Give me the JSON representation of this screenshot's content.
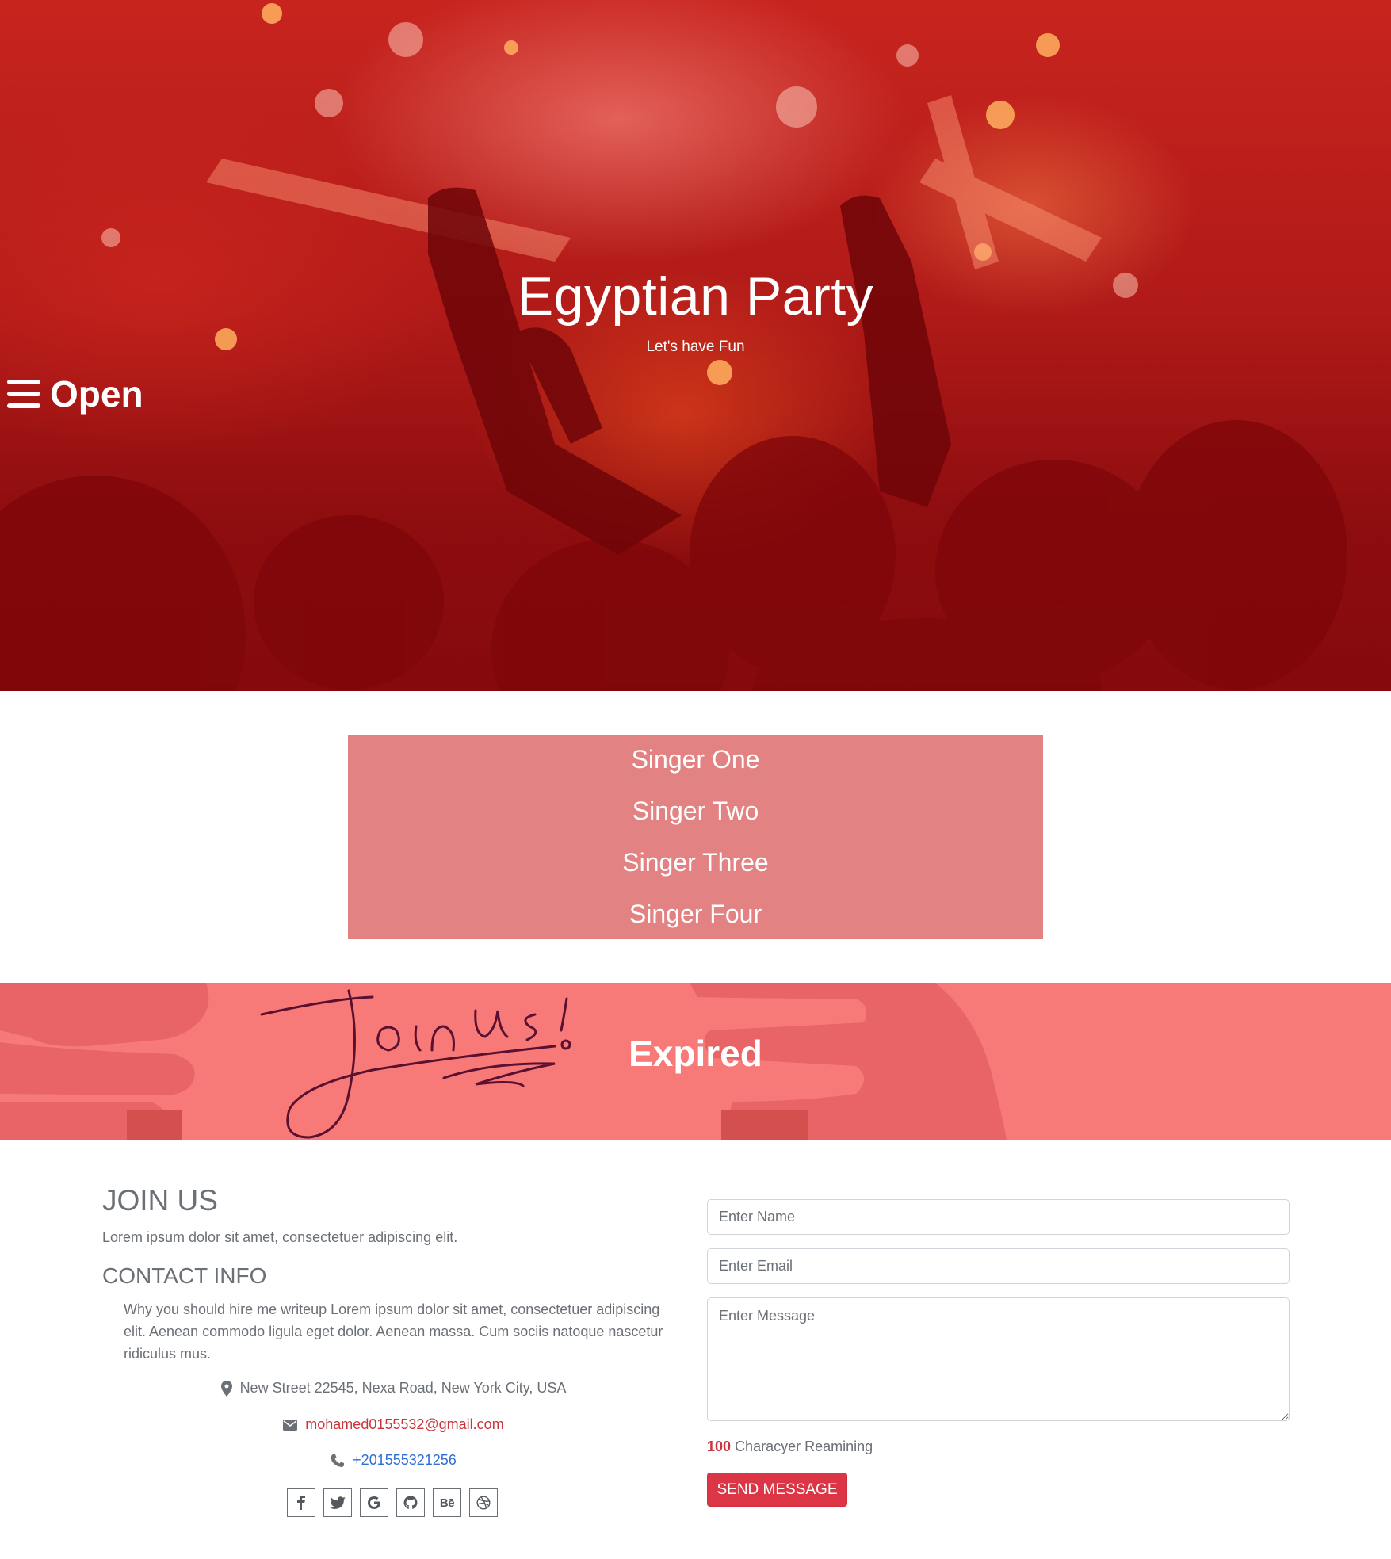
{
  "hero": {
    "title": "Egyptian Party",
    "subtitle": "Let's have Fun",
    "menu_label": "Open",
    "menu_icon": "hamburger-icon"
  },
  "singers": {
    "items": [
      "Singer One",
      "Singer Two",
      "Singer Three",
      "Singer Four"
    ],
    "background": "#e38283"
  },
  "banner": {
    "status": "Expired",
    "background": "#f77a78"
  },
  "join": {
    "title": "JOIN US",
    "text": "Lorem ipsum dolor sit amet, consectetuer adipiscing elit."
  },
  "contact": {
    "title": "CONTACT INFO",
    "text": "Why you should hire me writeup Lorem ipsum dolor sit amet, consectetuer adipiscing elit. Aenean commodo ligula eget dolor. Aenean massa. Cum sociis natoque nascetur ridiculus mus.",
    "address": "New Street 22545, Nexa Road, New York City, USA",
    "email": "mohamed0155532@gmail.com",
    "phone": "+201555321256",
    "social_icons": [
      "facebook-icon",
      "twitter-icon",
      "google-icon",
      "github-icon",
      "behance-icon",
      "dribbble-icon"
    ]
  },
  "form": {
    "name_placeholder": "Enter Name",
    "email_placeholder": "Enter Email",
    "message_placeholder": "Enter Message",
    "counter_value": "100",
    "counter_label": "Characyer Reamining",
    "send_label": "SEND MESSAGE",
    "accent": "#dc3545"
  }
}
